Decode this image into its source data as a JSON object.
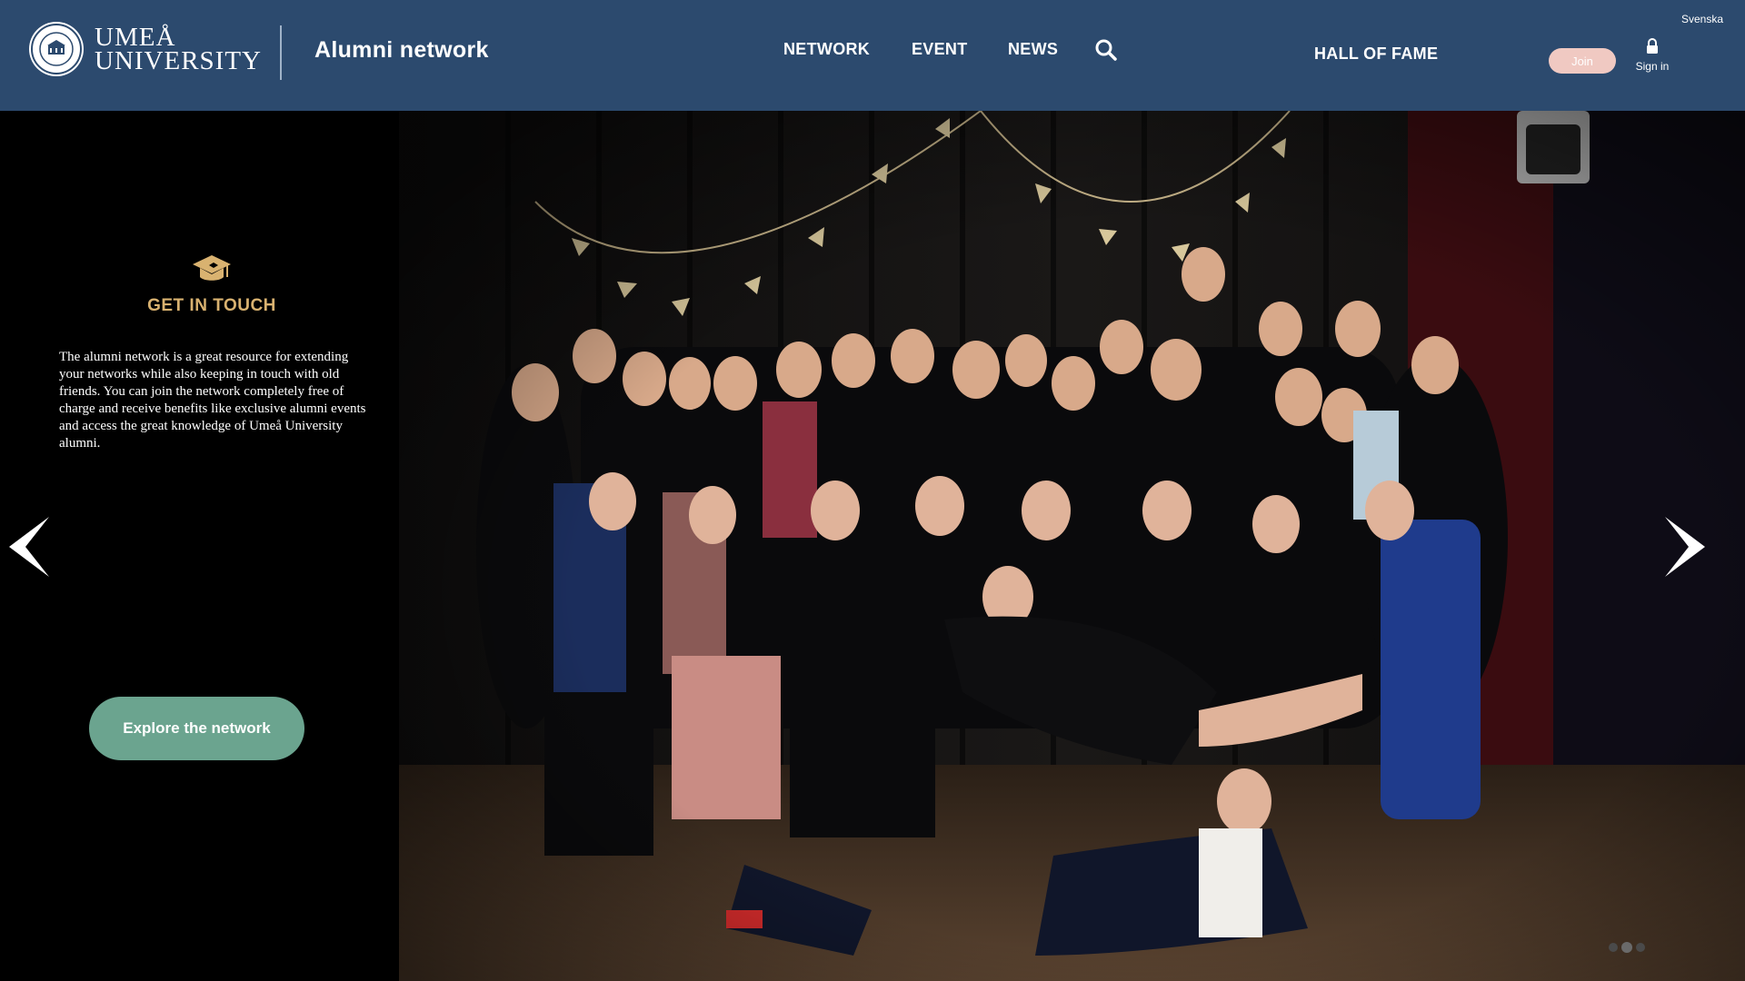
{
  "header": {
    "logo_line1": "UMEÅ",
    "logo_line2": "UNIVERSITY",
    "site_title": "Alumni network",
    "nav": {
      "network": "NETWORK",
      "event": "EVENT",
      "news": "NEWS",
      "search_icon": "search-icon",
      "hall_of_fame": "HALL OF FAME"
    },
    "join_label": "Join",
    "signin_label": "Sign in",
    "signin_icon": "lock-icon",
    "language_label": "Svenska"
  },
  "hero": {
    "icon": "graduation-cap-icon",
    "title": "GET IN TOUCH",
    "intro": "The alumni network is a great resource for extending your networks while also keeping in touch with old friends. You can join the network completely free of charge and receive benefits like exclusive alumni events and access the great knowledge of Umeå University alumni.",
    "cta_label": "Explore the network",
    "prev_icon": "chevron-left-icon",
    "next_icon": "chevron-right-icon",
    "slide_count": 3,
    "active_slide": 2
  },
  "colors": {
    "header_bg": "#2c4a6e",
    "accent_gold": "#d9b270",
    "cta_green": "#6ba48f",
    "join_pink": "#f0c9c2"
  }
}
